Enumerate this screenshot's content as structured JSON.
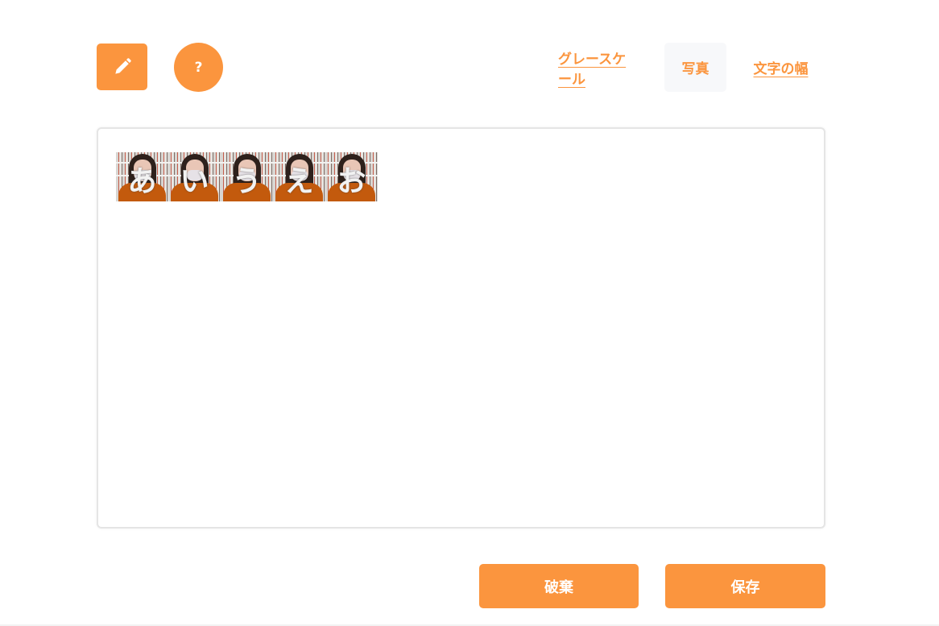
{
  "toolbar": {
    "edit_icon": "pencil-icon",
    "help_label": "?"
  },
  "tabs": [
    {
      "label": "グレースケール",
      "active": false
    },
    {
      "label": "写真",
      "active": true
    },
    {
      "label": "文字の幅",
      "active": false
    }
  ],
  "editor": {
    "glyphs": [
      "あ",
      "い",
      "う",
      "え",
      "お"
    ]
  },
  "actions": {
    "discard_label": "破棄",
    "save_label": "保存"
  },
  "colors": {
    "accent": "#fb953e",
    "active_tab_bg": "#f7f8fa"
  }
}
